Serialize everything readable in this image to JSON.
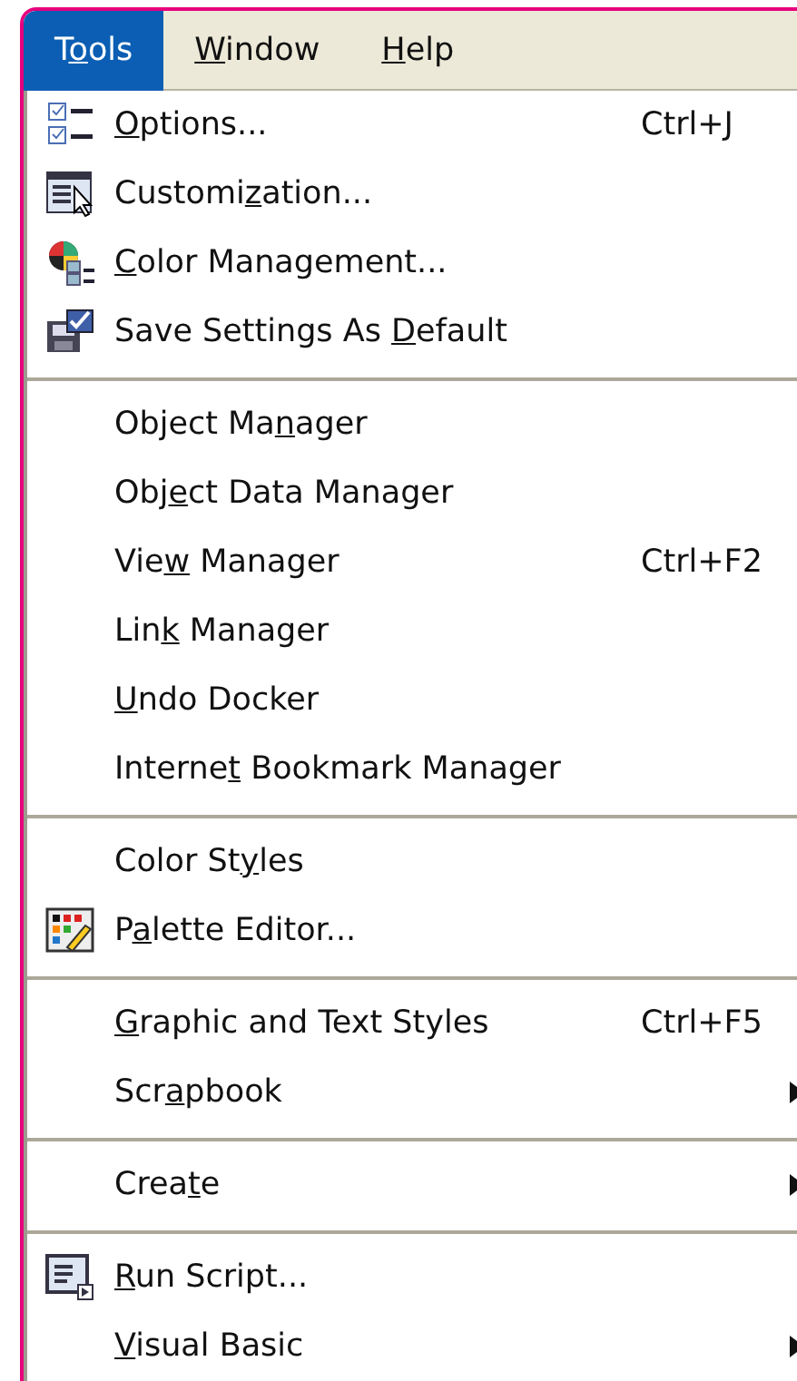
{
  "menubar": [
    {
      "label": [
        {
          "text": "T",
          "underlined": false
        },
        {
          "text": "o",
          "underlined": true
        },
        {
          "text": "ols",
          "underlined": false
        }
      ],
      "selected": true
    },
    {
      "label": [
        {
          "text": "W",
          "underlined": true
        },
        {
          "text": "indow",
          "underlined": false
        }
      ],
      "selected": false
    },
    {
      "label": [
        {
          "text": "H",
          "underlined": true
        },
        {
          "text": "elp",
          "underlined": false
        }
      ],
      "selected": false
    }
  ],
  "menu": [
    {
      "kind": "item",
      "label": [
        {
          "text": "O",
          "underlined": true
        },
        {
          "text": "ptions...",
          "underlined": false
        }
      ],
      "shortcut": "Ctrl+J",
      "submenu": false
    },
    {
      "kind": "item",
      "label": [
        {
          "text": "Customi",
          "underlined": false
        },
        {
          "text": "z",
          "underlined": true
        },
        {
          "text": "ation...",
          "underlined": false
        }
      ],
      "submenu": false
    },
    {
      "kind": "item",
      "label": [
        {
          "text": "C",
          "underlined": true
        },
        {
          "text": "olor Management...",
          "underlined": false
        }
      ],
      "submenu": false
    },
    {
      "kind": "item",
      "label": [
        {
          "text": "Save Settings As ",
          "underlined": false
        },
        {
          "text": "D",
          "underlined": true
        },
        {
          "text": "efault",
          "underlined": false
        }
      ],
      "submenu": false
    },
    {
      "kind": "separator"
    },
    {
      "kind": "item",
      "label": [
        {
          "text": "Object Ma",
          "underlined": false
        },
        {
          "text": "n",
          "underlined": true
        },
        {
          "text": "ager",
          "underlined": false
        }
      ],
      "submenu": false
    },
    {
      "kind": "item",
      "label": [
        {
          "text": "Obj",
          "underlined": false
        },
        {
          "text": "e",
          "underlined": true
        },
        {
          "text": "ct Data Manager",
          "underlined": false
        }
      ],
      "submenu": false
    },
    {
      "kind": "item",
      "label": [
        {
          "text": "Vie",
          "underlined": false
        },
        {
          "text": "w",
          "underlined": true
        },
        {
          "text": " Manager",
          "underlined": false
        }
      ],
      "shortcut": "Ctrl+F2",
      "submenu": false
    },
    {
      "kind": "item",
      "label": [
        {
          "text": "Lin",
          "underlined": false
        },
        {
          "text": "k",
          "underlined": true
        },
        {
          "text": " Manager",
          "underlined": false
        }
      ],
      "submenu": false
    },
    {
      "kind": "item",
      "label": [
        {
          "text": "U",
          "underlined": true
        },
        {
          "text": "ndo Docker",
          "underlined": false
        }
      ],
      "submenu": false
    },
    {
      "kind": "item",
      "label": [
        {
          "text": "Interne",
          "underlined": false
        },
        {
          "text": "t",
          "underlined": true
        },
        {
          "text": " Bookmark Manager",
          "underlined": false
        }
      ],
      "submenu": false
    },
    {
      "kind": "separator"
    },
    {
      "kind": "item",
      "label": [
        {
          "text": "Color St",
          "underlined": false
        },
        {
          "text": "y",
          "underlined": true
        },
        {
          "text": "les",
          "underlined": false
        }
      ],
      "submenu": false
    },
    {
      "kind": "item",
      "label": [
        {
          "text": "P",
          "underlined": false
        },
        {
          "text": "a",
          "underlined": true
        },
        {
          "text": "lette Editor...",
          "underlined": false
        }
      ],
      "submenu": false
    },
    {
      "kind": "separator"
    },
    {
      "kind": "item",
      "label": [
        {
          "text": "G",
          "underlined": true
        },
        {
          "text": "raphic and Text Styles",
          "underlined": false
        }
      ],
      "shortcut": "Ctrl+F5",
      "submenu": false
    },
    {
      "kind": "item",
      "label": [
        {
          "text": "Scr",
          "underlined": false
        },
        {
          "text": "a",
          "underlined": true
        },
        {
          "text": "pbook",
          "underlined": false
        }
      ],
      "submenu": true
    },
    {
      "kind": "separator"
    },
    {
      "kind": "item",
      "label": [
        {
          "text": "Crea",
          "underlined": false
        },
        {
          "text": "t",
          "underlined": true
        },
        {
          "text": "e",
          "underlined": false
        }
      ],
      "submenu": true
    },
    {
      "kind": "separator"
    },
    {
      "kind": "item",
      "label": [
        {
          "text": "R",
          "underlined": true
        },
        {
          "text": "un Script...",
          "underlined": false
        }
      ],
      "submenu": false
    },
    {
      "kind": "item",
      "label": [
        {
          "text": "V",
          "underlined": true
        },
        {
          "text": "isual Basic",
          "underlined": false
        }
      ],
      "submenu": true
    }
  ]
}
